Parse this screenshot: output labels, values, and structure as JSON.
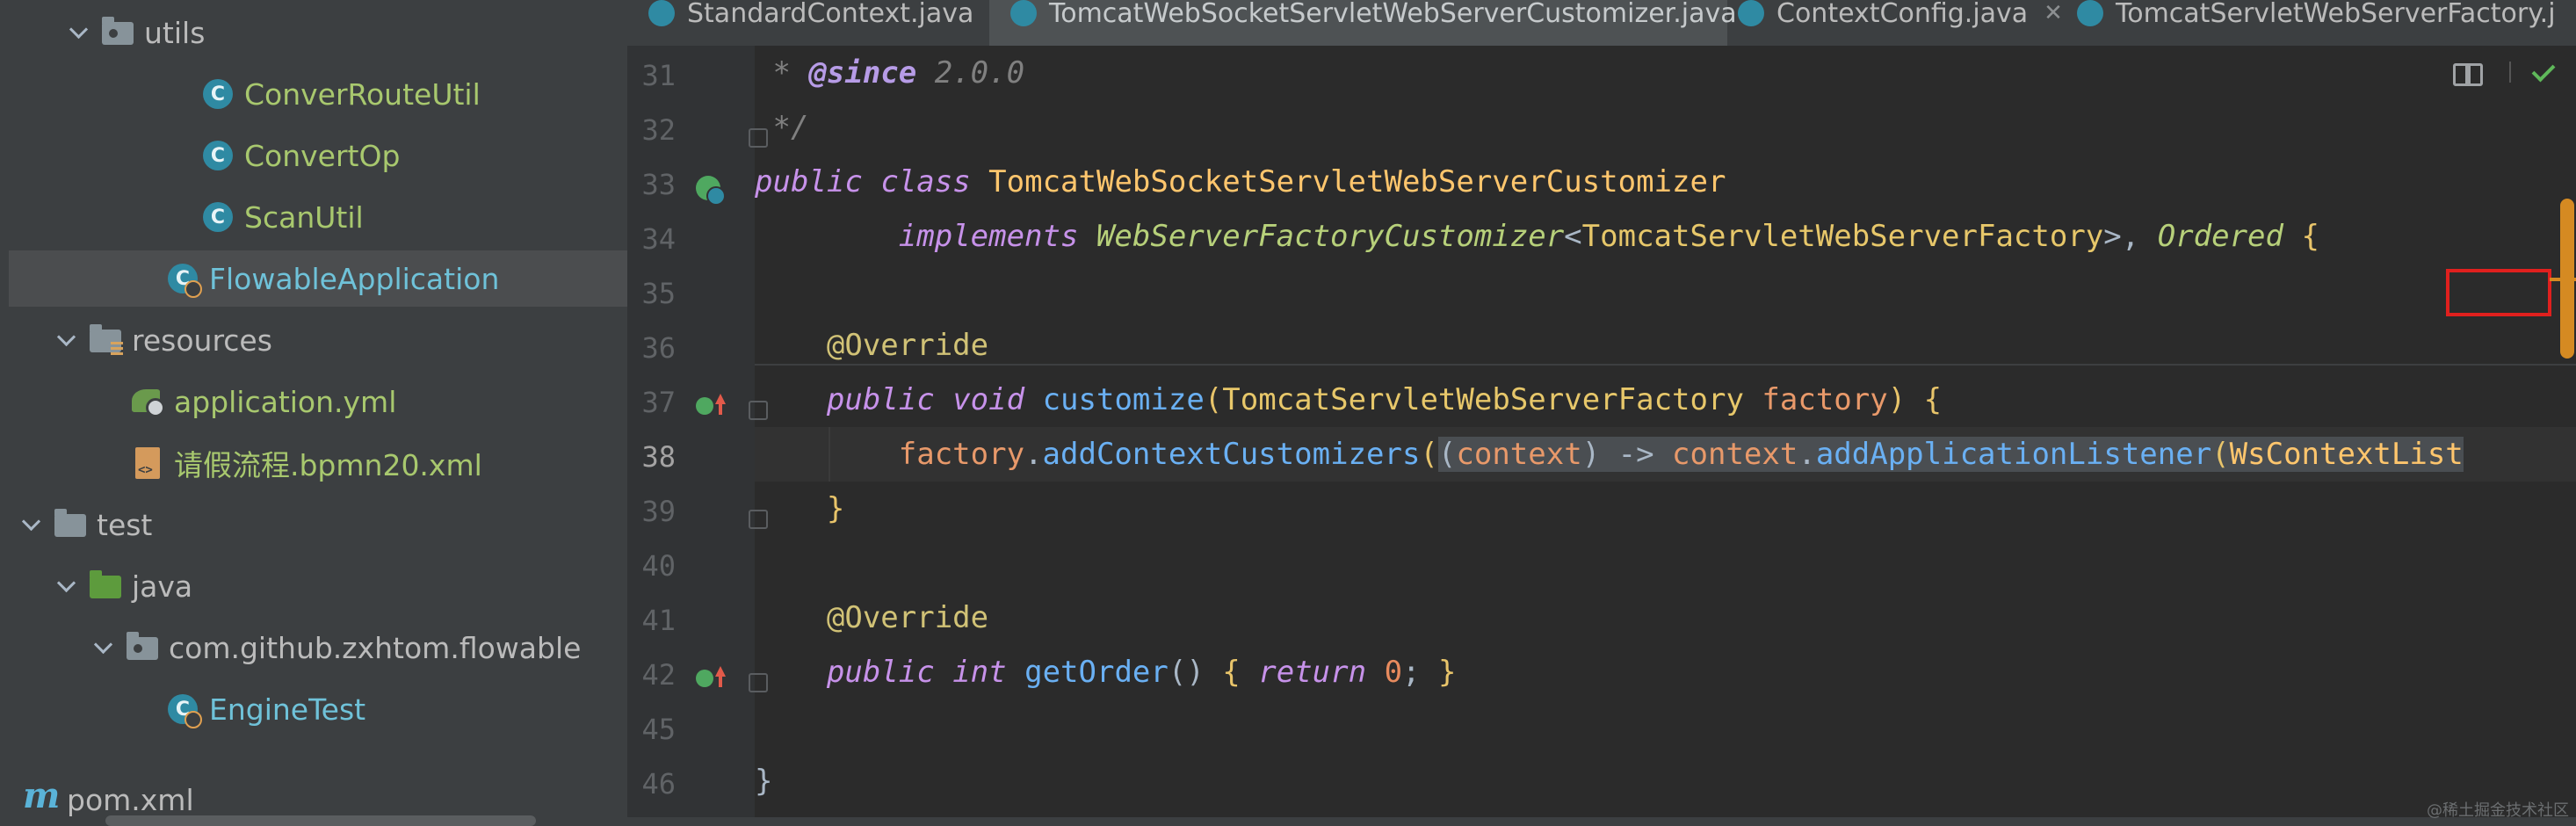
{
  "project_tree": {
    "items": [
      {
        "label": "utils",
        "kind": "package"
      },
      {
        "label": "ConverRouteUtil",
        "kind": "class"
      },
      {
        "label": "ConvertOp",
        "kind": "class"
      },
      {
        "label": "ScanUtil",
        "kind": "class"
      },
      {
        "label": "FlowableApplication",
        "kind": "spring-class",
        "selected": true
      },
      {
        "label": "resources",
        "kind": "resources"
      },
      {
        "label": "application.yml",
        "kind": "yml"
      },
      {
        "label": "请假流程.bpmn20.xml",
        "kind": "xml"
      },
      {
        "label": "test",
        "kind": "folder"
      },
      {
        "label": "java",
        "kind": "source-folder"
      },
      {
        "label": "com.github.zxhtom.flowable",
        "kind": "package"
      },
      {
        "label": "EngineTest",
        "kind": "spring-class"
      },
      {
        "label": "pom.xml",
        "kind": "maven"
      }
    ]
  },
  "tabs": [
    {
      "label": "StandardContext.java",
      "active": false
    },
    {
      "label": "TomcatWebSocketServletWebServerCustomizer.java",
      "active": true
    },
    {
      "label": "ContextConfig.java",
      "active": false
    },
    {
      "label": "TomcatServletWebServerFactory.j",
      "active": false
    }
  ],
  "line_numbers": [
    "31",
    "32",
    "33",
    "34",
    "35",
    "36",
    "37",
    "38",
    "39",
    "40",
    "41",
    "42",
    "45",
    "46"
  ],
  "current_line": "38",
  "code": {
    "l31": {
      "star": " * ",
      "tag": "@since",
      "rest": " 2.0.0"
    },
    "l32": {
      "text": " */"
    },
    "l33": {
      "kw1": "public",
      "kw2": "class",
      "cls": "TomcatWebSocketServletWebServerCustomizer"
    },
    "l34": {
      "kw": "implements",
      "ifc": "WebServerFactoryCustomizer",
      "lt": "<",
      "type": "TomcatServletWebServerFactory",
      "gt": ">, ",
      "ifc2": "Ordered",
      "brace": " {"
    },
    "l36": {
      "ann": "@Override"
    },
    "l37": {
      "kw1": "public",
      "kw2": "void",
      "fn": "customize",
      "open": "(",
      "type": "TomcatServletWebServerFactory",
      "par": "factory",
      "close": ") {"
    },
    "l38": {
      "obj": "factory",
      "dot": ".",
      "fn": "addContextCustomizers",
      "open": "(",
      "lam_open": "(",
      "par": "context",
      "lam_close": ") -> ",
      "obj2": "context",
      "dot2": ".",
      "fn2": "addApplicationListener",
      "open2": "(",
      "cls": "WsContextList"
    },
    "l39": {
      "text": "}"
    },
    "l41": {
      "ann": "@Override"
    },
    "l42": {
      "kw1": "public",
      "kw2": "int",
      "fn": "getOrder",
      "parens": "() ",
      "brace1": "{ ",
      "kw3": "return",
      "num": "0",
      "semi": "; ",
      "brace2": "}"
    },
    "l46": {
      "text": "}"
    }
  },
  "toolbar_icons": [
    "reader-mode-icon",
    "inspection-ok-icon"
  ],
  "watermark": "@稀土掘金技术社区",
  "colors": {
    "accent_tab": "#d6a35c",
    "highlight_box": "#e0201e",
    "scroll": "#d58a22"
  }
}
